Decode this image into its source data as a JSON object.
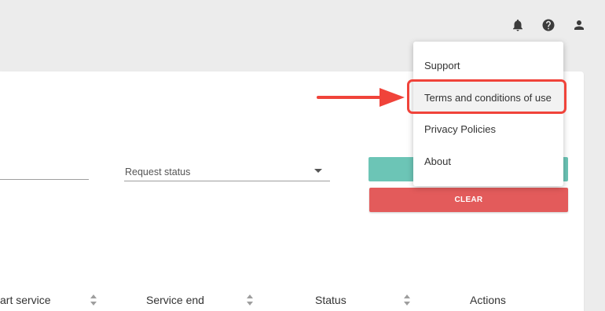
{
  "header": {
    "icons": [
      "bell-icon",
      "help-icon",
      "account-icon"
    ]
  },
  "filters": {
    "request_status_label": "Request status"
  },
  "buttons": {
    "clear_label": "CLEAR"
  },
  "table": {
    "headers": [
      "art service",
      "Service end",
      "Status",
      "Actions"
    ]
  },
  "menu": {
    "items": [
      {
        "label": "Support"
      },
      {
        "label": "Terms and conditions of use"
      },
      {
        "label": "Privacy Policies"
      },
      {
        "label": "About"
      }
    ]
  },
  "colors": {
    "search_button": "#6cc5b6",
    "clear_button": "#e35b5b",
    "annotation": "#f0433a"
  }
}
